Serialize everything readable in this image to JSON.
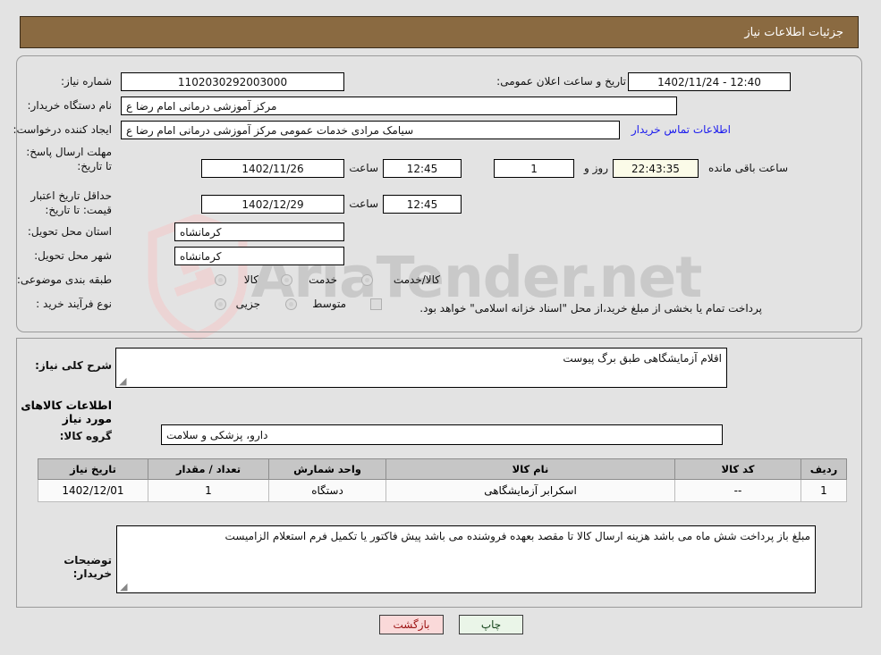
{
  "header": {
    "title": "جزئیات اطلاعات نیاز",
    "bg": "#8a6a41"
  },
  "watermark": {
    "text": "AriaTender.net"
  },
  "form": {
    "need_number": {
      "label": "شماره نیاز:",
      "value": "1102030292003000"
    },
    "buyer_org": {
      "label": "نام دستگاه خریدار:",
      "value": "مرکز آموزشی  درمانی امام رضا  ع"
    },
    "requester": {
      "label": "ایجاد کننده درخواست:",
      "value": "سیامک مرادی خدمات عمومی مرکز آموزشی  درمانی امام رضا  ع"
    },
    "public_announce": {
      "label": "تاریخ و ساعت اعلان عمومی:",
      "value": "12:40 - 1402/11/24"
    },
    "contact_link": {
      "label": "اطلاعات تماس خریدار"
    },
    "reply_deadline": {
      "label": "مهلت ارسال پاسخ: تا تاریخ:",
      "date": "1402/11/26",
      "time_label": "ساعت",
      "time": "12:45"
    },
    "countdown": {
      "days": "1",
      "days_sep": "روز و",
      "clock": "22:43:35",
      "suffix": "ساعت باقی مانده"
    },
    "price_validity": {
      "label": "حداقل تاریخ اعتبار قیمت: تا تاریخ:",
      "date": "1402/12/29",
      "time_label": "ساعت",
      "time": "12:45"
    },
    "province": {
      "label": "استان محل تحویل:",
      "value": "کرمانشاه"
    },
    "city": {
      "label": "شهر محل تحویل:",
      "value": "کرمانشاه"
    },
    "classification": {
      "label": "طبقه بندی موضوعی:",
      "options": [
        "کالا",
        "خدمت",
        "کالا/خدمت"
      ]
    },
    "process_type": {
      "label": "نوع فرآیند خرید :",
      "options": [
        "جزیی",
        "متوسط"
      ],
      "note": "پرداخت تمام یا بخشی از مبلغ خرید،از محل \"اسناد خزانه اسلامی\" خواهد بود."
    }
  },
  "need_summary": {
    "label": "شرح کلی نیاز:",
    "value": "اقلام آزمایشگاهی طبق برگ پیوست"
  },
  "goods_section": {
    "heading": "اطلاعات کالاهای مورد نیاز",
    "group_label": "گروه کالا:",
    "group_value": "دارو، پزشکی و سلامت"
  },
  "items_table": {
    "columns": [
      "ردیف",
      "کد کالا",
      "نام کالا",
      "واحد شمارش",
      "تعداد / مقدار",
      "تاریخ نیاز"
    ],
    "rows": [
      {
        "radif": "1",
        "code": "--",
        "name": "اسکرابر آزمایشگاهی",
        "unit": "دستگاه",
        "qty": "1",
        "need_date": "1402/12/01"
      }
    ]
  },
  "buyer_notes": {
    "label": "توضیحات خریدار:",
    "value": "مبلغ باز پرداخت شش ماه می باشد هزینه ارسال کالا تا مقصد بعهده فروشنده می باشد پیش فاکتور یا تکمیل فرم استعلام الزامیست"
  },
  "buttons": {
    "print": "چاپ",
    "back": "بازگشت"
  }
}
